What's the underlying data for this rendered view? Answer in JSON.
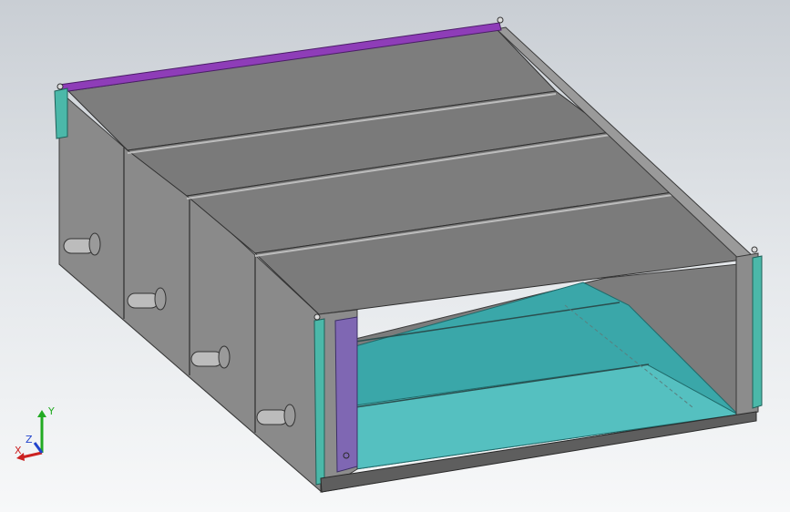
{
  "viewport": {
    "background_top": "#c9ced4",
    "background_bottom": "#f7f8f9"
  },
  "model": {
    "body_color": "#8a8a8a",
    "body_dark": "#6f6f6f",
    "top_panel_color": "#7e7e7e",
    "interior_color": "#3aa7a9",
    "interior_light": "#55c0c0",
    "side_rail_color": "#4bb8a9",
    "purple_rail_color": "#8e3db8",
    "purple_post_color": "#7f67b3",
    "port_count": 4,
    "top_panel_count": 4
  },
  "triad": {
    "x_label": "X",
    "y_label": "Y",
    "z_label": "Z",
    "x_color": "#cc2222",
    "y_color": "#22aa22",
    "z_color": "#2244cc"
  }
}
